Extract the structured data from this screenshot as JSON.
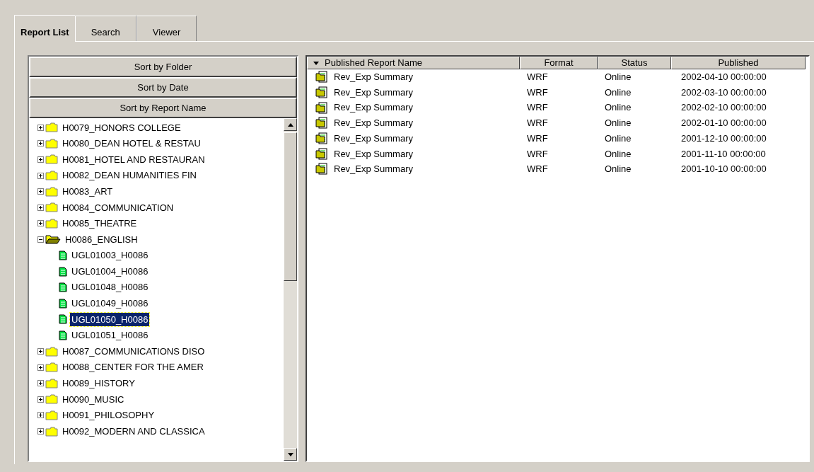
{
  "tabs": [
    {
      "label": "Report List",
      "selected": true
    },
    {
      "label": "Search",
      "selected": false
    },
    {
      "label": "Viewer",
      "selected": false
    }
  ],
  "sort_buttons": [
    "Sort by Folder",
    "Sort by Date",
    "Sort by Report Name"
  ],
  "tree": [
    {
      "label": "H0079_HONORS COLLEGE",
      "expanded": false,
      "selected": false
    },
    {
      "label": "H0080_DEAN HOTEL & RESTAU",
      "expanded": false,
      "selected": false
    },
    {
      "label": "H0081_HOTEL AND RESTAURAN",
      "expanded": false,
      "selected": false
    },
    {
      "label": "H0082_DEAN HUMANITIES FIN",
      "expanded": false,
      "selected": false
    },
    {
      "label": "H0083_ART",
      "expanded": false,
      "selected": false
    },
    {
      "label": "H0084_COMMUNICATION",
      "expanded": false,
      "selected": false
    },
    {
      "label": "H0085_THEATRE",
      "expanded": false,
      "selected": false
    },
    {
      "label": "H0086_ENGLISH",
      "expanded": true,
      "selected": false,
      "children": [
        {
          "label": "UGL01003_H0086",
          "selected": false
        },
        {
          "label": "UGL01004_H0086",
          "selected": false
        },
        {
          "label": "UGL01048_H0086",
          "selected": false
        },
        {
          "label": "UGL01049_H0086",
          "selected": false
        },
        {
          "label": "UGL01050_H0086",
          "selected": true
        },
        {
          "label": "UGL01051_H0086",
          "selected": false
        }
      ]
    },
    {
      "label": "H0087_COMMUNICATIONS DISO",
      "expanded": false,
      "selected": false
    },
    {
      "label": "H0088_CENTER FOR THE AMER",
      "expanded": false,
      "selected": false
    },
    {
      "label": "H0089_HISTORY",
      "expanded": false,
      "selected": false
    },
    {
      "label": "H0090_MUSIC",
      "expanded": false,
      "selected": false
    },
    {
      "label": "H0091_PHILOSOPHY",
      "expanded": false,
      "selected": false
    },
    {
      "label": "H0092_MODERN AND CLASSICA",
      "expanded": false,
      "selected": false
    }
  ],
  "table": {
    "columns": [
      "Published Report Name",
      "Format",
      "Status",
      "Published"
    ],
    "rows": [
      [
        "Rev_Exp Summary",
        "WRF",
        "Online",
        "2002-04-10 00:00:00"
      ],
      [
        "Rev_Exp Summary",
        "WRF",
        "Online",
        "2002-03-10 00:00:00"
      ],
      [
        "Rev_Exp Summary",
        "WRF",
        "Online",
        "2002-02-10 00:00:00"
      ],
      [
        "Rev_Exp Summary",
        "WRF",
        "Online",
        "2002-01-10 00:00:00"
      ],
      [
        "Rev_Exp Summary",
        "WRF",
        "Online",
        "2001-12-10 00:00:00"
      ],
      [
        "Rev_Exp Summary",
        "WRF",
        "Online",
        "2001-11-10 00:00:00"
      ],
      [
        "Rev_Exp Summary",
        "WRF",
        "Online",
        "2001-10-10 00:00:00"
      ]
    ]
  }
}
